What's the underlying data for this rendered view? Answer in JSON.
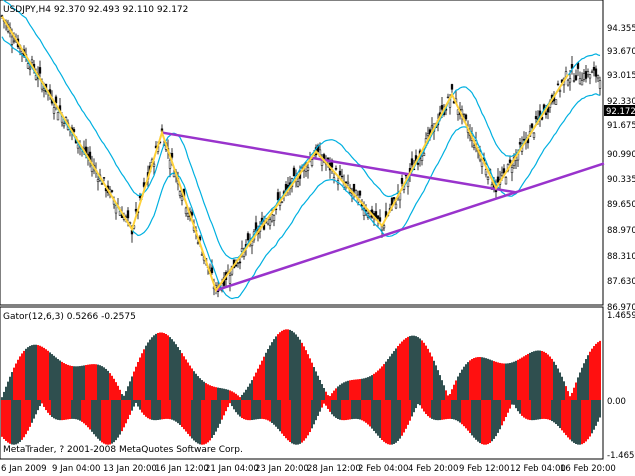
{
  "colors": {
    "background": "#ffffff",
    "candle_body": "#000000",
    "envelope": "#00b0e0",
    "zigzag": "#ffd23a",
    "trendline": "#9933cc",
    "gator_red": "#ff1010",
    "gator_green": "#2f4f4f",
    "price_box": "#000000"
  },
  "main": {
    "title": "USDJPY,H4 92.370 92.493 92.110 92.172",
    "price_label": "92.172",
    "last_price_label": "92.330",
    "yticks": [
      "94.355",
      "93.670",
      "93.015",
      "92.330",
      "91.675",
      "90.990",
      "90.335",
      "89.650",
      "88.970",
      "88.310",
      "87.630",
      "86.970"
    ]
  },
  "gator": {
    "title": "Gator(12,6,3) 0.5266 -0.2575",
    "ticks": [
      "1.4659",
      "0.00",
      "-1.4659"
    ],
    "copyright": "MetaTrader, ? 2001-2008 MetaQuotes Software Corp."
  },
  "xticks": [
    "6 Jan 2009",
    "9 Jan 04:00",
    "13 Jan 20:00",
    "16 Jan 12:00",
    "21 Jan 04:00",
    "23 Jan 20:00",
    "28 Jan 12:00",
    "2 Feb 04:00",
    "4 Feb 20:00",
    "9 Feb 12:00",
    "12 Feb 04:00",
    "16 Feb 20:00"
  ],
  "chart_data": {
    "type": "candlestick",
    "symbol": "USDJPY",
    "timeframe": "H4",
    "ylim": [
      86.6,
      94.9
    ],
    "zigzag": [
      {
        "x": 0,
        "y": 94.5
      },
      {
        "x": 65,
        "y": 88.63
      },
      {
        "x": 80,
        "y": 91.3
      },
      {
        "x": 107,
        "y": 86.95
      },
      {
        "x": 157,
        "y": 90.78
      },
      {
        "x": 190,
        "y": 88.73
      },
      {
        "x": 225,
        "y": 92.35
      },
      {
        "x": 247,
        "y": 89.77
      },
      {
        "x": 283,
        "y": 92.9
      }
    ],
    "trendlines": [
      {
        "from": {
          "x": 80,
          "y": 91.3
        },
        "to": {
          "x": 257,
          "y": 89.65
        }
      },
      {
        "from": {
          "x": 107,
          "y": 86.95
        },
        "to": {
          "x": 301,
          "y": 90.45
        }
      }
    ],
    "gator_ylim": [
      -1.5,
      1.5
    ]
  }
}
